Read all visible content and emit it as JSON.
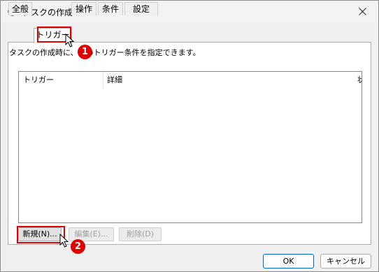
{
  "window": {
    "title": "タスクの作成"
  },
  "tabs": [
    {
      "label": "全般"
    },
    {
      "label": "トリガー"
    },
    {
      "label": "操作"
    },
    {
      "label": "条件"
    },
    {
      "label": "設定"
    }
  ],
  "triggers": {
    "description": "タスクの作成時に、このトリガー条件を指定できます。",
    "columns": [
      "トリガー",
      "詳細",
      "状"
    ],
    "buttons": {
      "new": "新規(N)...",
      "edit": "編集(E)...",
      "delete": "削除(D)"
    }
  },
  "annotations": {
    "step1": "1",
    "step2": "2",
    "highlight_color": "#e00000"
  },
  "footer": {
    "ok": "OK",
    "cancel": "キャンセル"
  }
}
